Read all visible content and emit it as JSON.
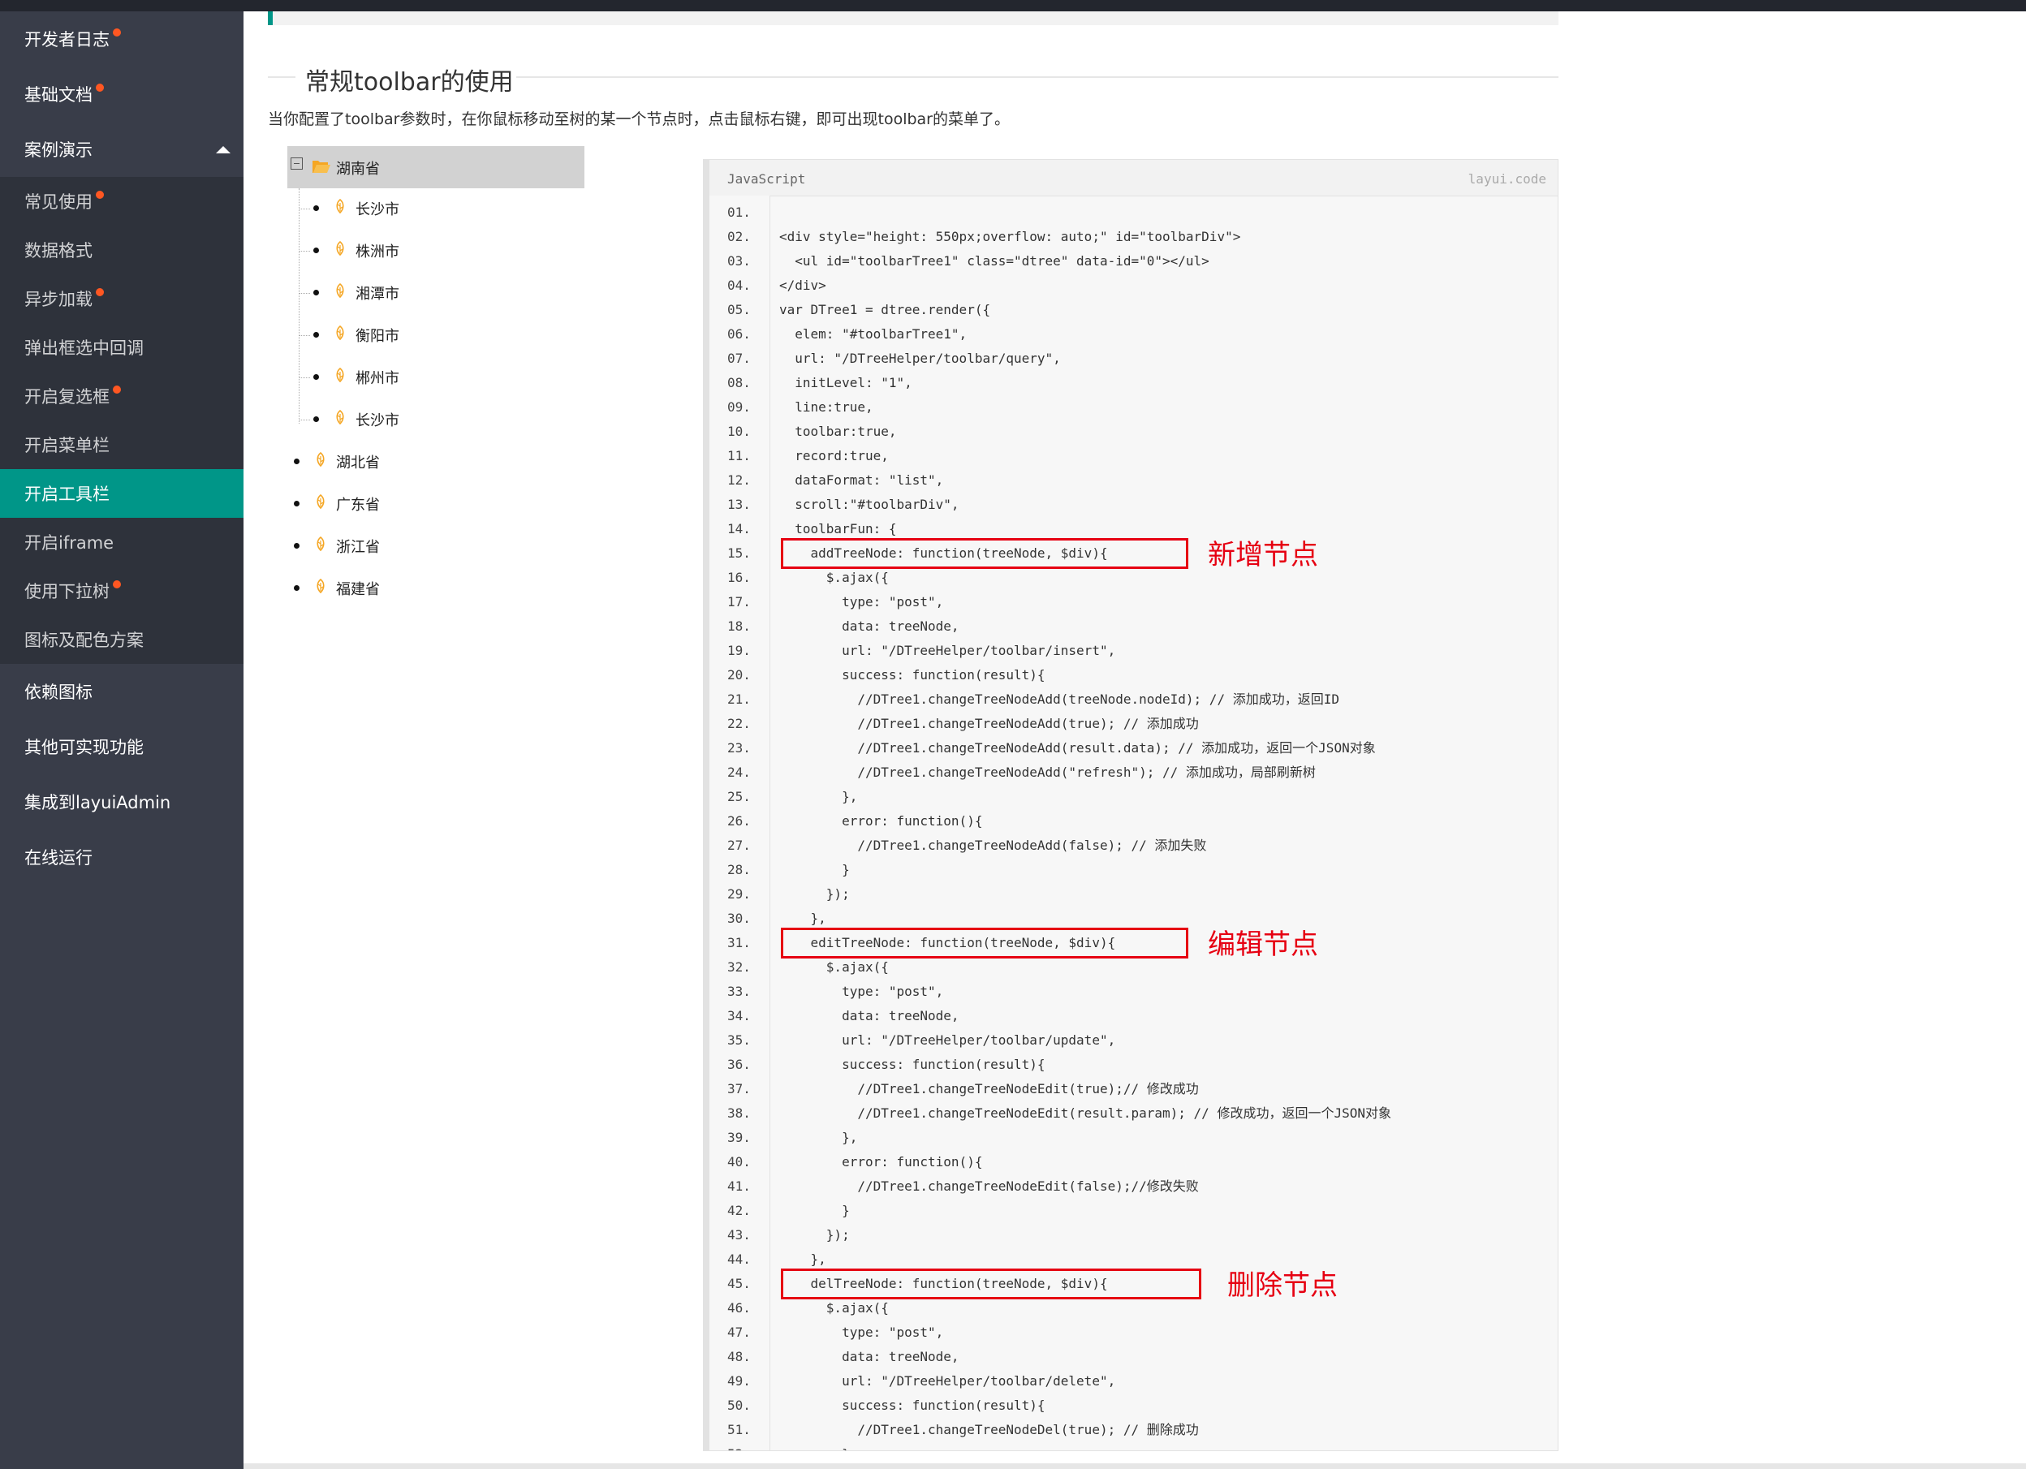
{
  "sidebar": {
    "items": [
      {
        "label": "开发者日志",
        "dot": true,
        "type": "top"
      },
      {
        "label": "基础文档",
        "dot": true,
        "type": "top"
      },
      {
        "label": "案例演示",
        "dot": false,
        "type": "top",
        "expanded": true
      },
      {
        "label": "常见使用",
        "dot": true,
        "type": "sub"
      },
      {
        "label": "数据格式",
        "dot": false,
        "type": "sub"
      },
      {
        "label": "异步加载",
        "dot": true,
        "type": "sub"
      },
      {
        "label": "弹出框选中回调",
        "dot": false,
        "type": "sub"
      },
      {
        "label": "开启复选框",
        "dot": true,
        "type": "sub"
      },
      {
        "label": "开启菜单栏",
        "dot": false,
        "type": "sub"
      },
      {
        "label": "开启工具栏",
        "dot": false,
        "type": "sub",
        "active": true
      },
      {
        "label": "开启iframe",
        "dot": false,
        "type": "sub"
      },
      {
        "label": "使用下拉树",
        "dot": true,
        "type": "sub"
      },
      {
        "label": "图标及配色方案",
        "dot": false,
        "type": "sub"
      },
      {
        "label": "依赖图标",
        "dot": false,
        "type": "top"
      },
      {
        "label": "其他可实现功能",
        "dot": false,
        "type": "top"
      },
      {
        "label": "集成到layuiAdmin",
        "dot": false,
        "type": "top"
      },
      {
        "label": "在线运行",
        "dot": false,
        "type": "top"
      }
    ]
  },
  "section": {
    "title": "常规toolbar的使用",
    "description": "当你配置了toolbar参数时，在你鼠标移动至树的某一个节点时，点击鼠标右键，即可出现toolbar的菜单了。"
  },
  "tree": {
    "root": {
      "label": "湖南省",
      "expanded": true,
      "selected": true,
      "children": [
        "长沙市",
        "株洲市",
        "湘潭市",
        "衡阳市",
        "郴州市",
        "长沙市"
      ]
    },
    "others": [
      "湖北省",
      "广东省",
      "浙江省",
      "福建省"
    ]
  },
  "code": {
    "language": "JavaScript",
    "source": "layui.code",
    "lines": [
      "",
      "<div style=\"height: 550px;overflow: auto;\" id=\"toolbarDiv\">",
      "  <ul id=\"toolbarTree1\" class=\"dtree\" data-id=\"0\"></ul>",
      "</div>",
      "var DTree1 = dtree.render({",
      "  elem: \"#toolbarTree1\",",
      "  url: \"/DTreeHelper/toolbar/query\",",
      "  initLevel: \"1\",",
      "  line:true,",
      "  toolbar:true,",
      "  record:true,",
      "  dataFormat: \"list\",",
      "  scroll:\"#toolbarDiv\",",
      "  toolbarFun: {",
      "    addTreeNode: function(treeNode, $div){",
      "      $.ajax({",
      "        type: \"post\",",
      "        data: treeNode,",
      "        url: \"/DTreeHelper/toolbar/insert\",",
      "        success: function(result){",
      "          //DTree1.changeTreeNodeAdd(treeNode.nodeId); // 添加成功，返回ID",
      "          //DTree1.changeTreeNodeAdd(true); // 添加成功",
      "          //DTree1.changeTreeNodeAdd(result.data); // 添加成功，返回一个JSON对象",
      "          //DTree1.changeTreeNodeAdd(\"refresh\"); // 添加成功，局部刷新树",
      "        },",
      "        error: function(){",
      "          //DTree1.changeTreeNodeAdd(false); // 添加失败",
      "        }",
      "      });",
      "    },",
      "    editTreeNode: function(treeNode, $div){",
      "      $.ajax({",
      "        type: \"post\",",
      "        data: treeNode,",
      "        url: \"/DTreeHelper/toolbar/update\",",
      "        success: function(result){",
      "          //DTree1.changeTreeNodeEdit(true);// 修改成功",
      "          //DTree1.changeTreeNodeEdit(result.param); // 修改成功，返回一个JSON对象",
      "        },",
      "        error: function(){",
      "          //DTree1.changeTreeNodeEdit(false);//修改失败",
      "        }",
      "      });",
      "    },",
      "    delTreeNode: function(treeNode, $div){",
      "      $.ajax({",
      "        type: \"post\",",
      "        data: treeNode,",
      "        url: \"/DTreeHelper/toolbar/delete\",",
      "        success: function(result){",
      "          //DTree1.changeTreeNodeDel(true); // 删除成功",
      "        }"
    ]
  },
  "annotations": [
    {
      "label": "新增节点",
      "line": 15
    },
    {
      "label": "编辑节点",
      "line": 31
    },
    {
      "label": "删除节点",
      "line": 45
    }
  ],
  "colors": {
    "accent": "#009688",
    "dot": "#ff5722",
    "annotation": "#e60012",
    "sidebar": "#393d49",
    "folder": "#f5a623"
  }
}
